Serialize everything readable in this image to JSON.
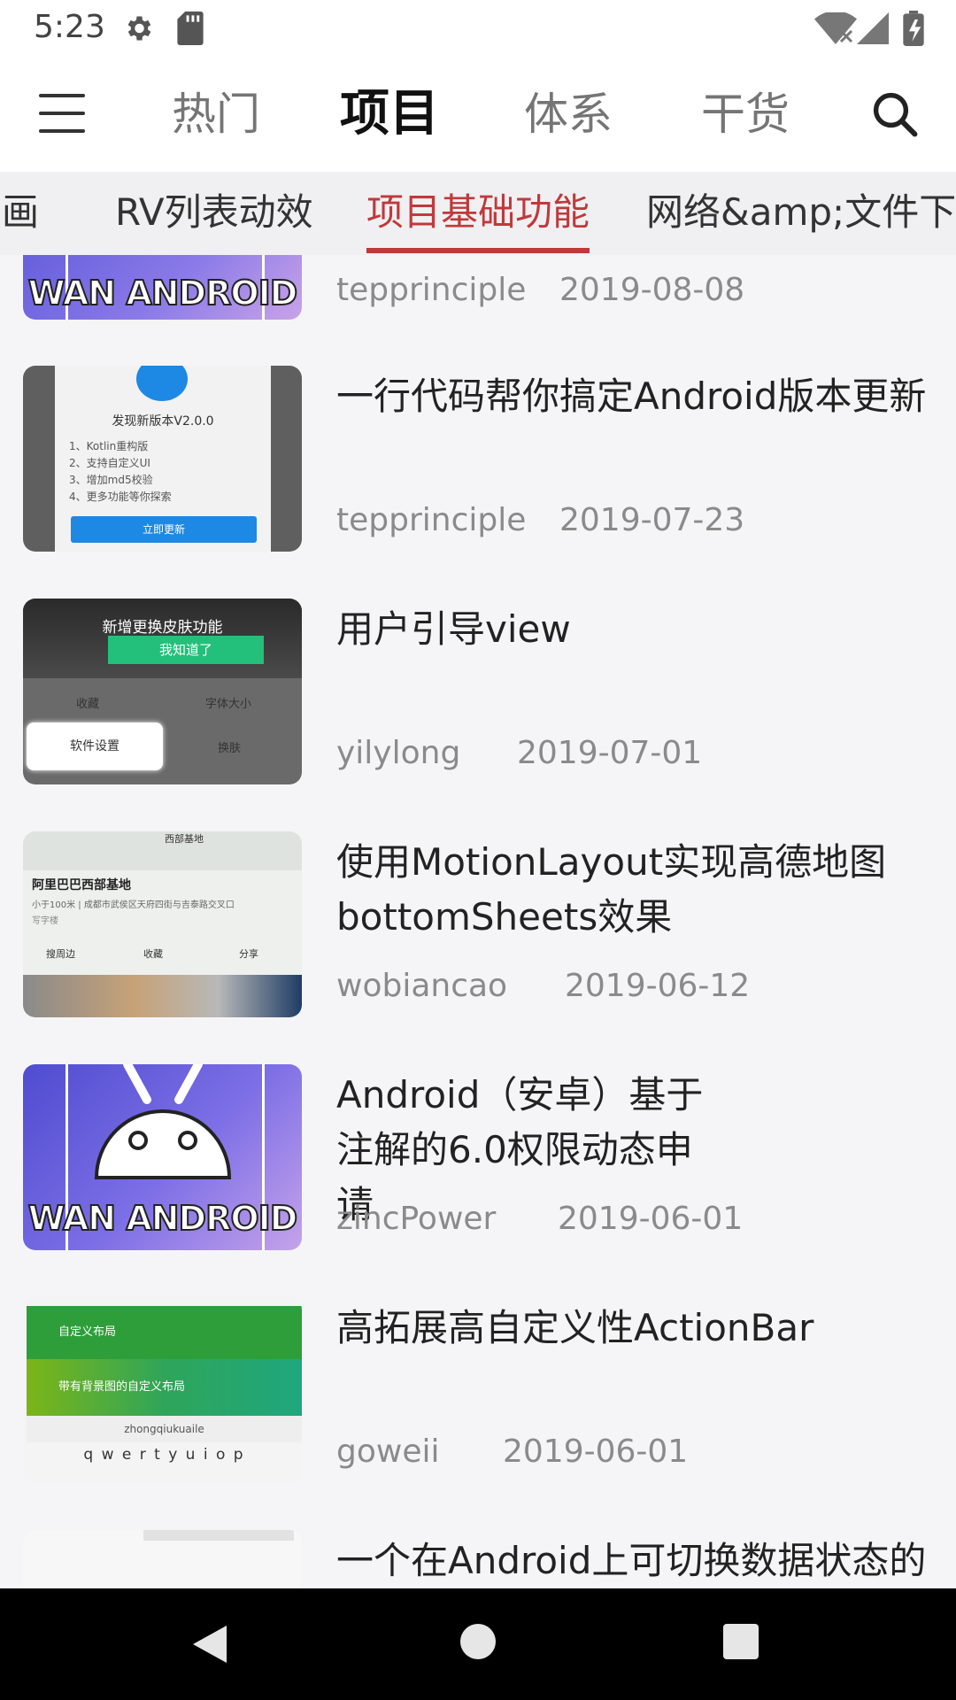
{
  "status_bar": {
    "time": "5:23"
  },
  "top_bar": {
    "tabs": [
      "热门",
      "项目",
      "体系",
      "干货"
    ],
    "active_tab": "项目"
  },
  "sub_tabs": {
    "items": [
      "画",
      "RV列表动效",
      "项目基础功能",
      "网络&amp;文件下载"
    ],
    "active": "项目基础功能"
  },
  "thumb_texts": {
    "wan_android": "WAN ANDROID",
    "update_title": "发现新版本V2.0.0",
    "update_lines": [
      "1、Kotlin重构版",
      "2、支持自定义UI",
      "3、增加md5校验",
      "4、更多功能等你探索"
    ],
    "update_button": "立即更新",
    "guide_banner": "新增更换皮肤功能",
    "guide_button": "我知道了",
    "guide_cells": [
      "收藏",
      "字体大小",
      "软件设置",
      "换肤"
    ],
    "map_top": "西部基地",
    "map_title": "阿里巴巴西部基地",
    "map_sub": "小于100米 | 成都市武侯区天府四街与吉泰路交叉口",
    "map_tag": "写字楼",
    "map_actions": [
      "搜周边",
      "收藏",
      "分享"
    ],
    "actionbar_row1": "自定义布局",
    "actionbar_row2": "带有背景图的自定义布局",
    "actionbar_input": "zhongqiukuaile",
    "actionbar_keys": "q w e r t y u i o p"
  },
  "articles": [
    {
      "title": "",
      "author": "tepprinciple",
      "date": "2019-08-08"
    },
    {
      "title": "一行代码帮你搞定Android版本更新",
      "author": "tepprinciple",
      "date": "2019-07-23"
    },
    {
      "title": "用户引导view",
      "author": "yilylong",
      "date": "2019-07-01"
    },
    {
      "title": "使用MotionLayout实现高德地图bottomSheets效果",
      "author": "wobiancao",
      "date": "2019-06-12"
    },
    {
      "title": "Android（安卓）基于注解的6.0权限动态申请",
      "author": "zincPower",
      "date": "2019-06-01"
    },
    {
      "title": "高拓展高自定义性ActionBar",
      "author": "goweii",
      "date": "2019-06-01"
    },
    {
      "title": "一个在Android上可切换数据状态的",
      "author": "",
      "date": ""
    }
  ],
  "colors": {
    "accent": "#c0393b",
    "background": "#f5f5f7"
  }
}
